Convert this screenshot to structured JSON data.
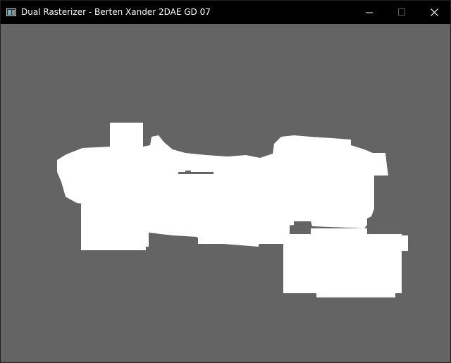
{
  "window": {
    "title": "Dual Rasterizer - Berten Xander 2DAE GD 07",
    "icon": "app-window-icon",
    "controls": {
      "minimize_icon": "minimize-icon",
      "maximize_icon": "maximize-icon",
      "close_icon": "close-icon"
    }
  },
  "viewport": {
    "background_color": "#646464",
    "render_color": "#ffffff",
    "content": "rendered-model-silhouette"
  }
}
